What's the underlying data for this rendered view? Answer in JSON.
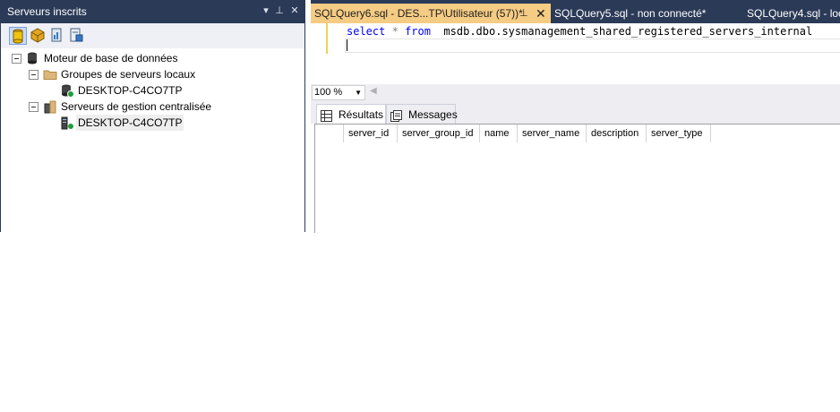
{
  "left_panel": {
    "title": "Serveurs inscrits",
    "title_buttons": [
      "▾",
      "⊥",
      "✕"
    ],
    "toolbar_icons": [
      "database-engine-icon",
      "analysis-services-icon",
      "reporting-services-icon",
      "integration-services-icon"
    ],
    "tree": [
      {
        "label": "Moteur de base de données"
      },
      {
        "label": "Groupes de serveurs locaux"
      },
      {
        "label": "DESKTOP-C4CO7TP"
      },
      {
        "label": "Serveurs de gestion centralisée"
      },
      {
        "label": "DESKTOP-C4CO7TP"
      }
    ]
  },
  "tabs": [
    {
      "label": "SQLQuery6.sql - DES...TP\\Utilisateur (57))*",
      "pin": "⊥",
      "close": "✕"
    },
    {
      "label": "SQLQuery5.sql - non connecté*"
    },
    {
      "label": "SQLQuery4.sql - loc"
    }
  ],
  "editor": {
    "kw_select": "select",
    "star": "*",
    "kw_from": "from",
    "object": "msdb.dbo.sysmanagement_shared_registered_servers_internal"
  },
  "zoom": {
    "value": "100 %"
  },
  "result_tabs": [
    {
      "label": "Résultats"
    },
    {
      "label": "Messages"
    }
  ],
  "grid": {
    "columns": [
      "server_id",
      "server_group_id",
      "name",
      "server_name",
      "description",
      "server_type"
    ]
  },
  "colors": {
    "chrome_dark": "#2b3a57",
    "active_tab": "#f5cc84",
    "keyword": "#0000ff"
  }
}
